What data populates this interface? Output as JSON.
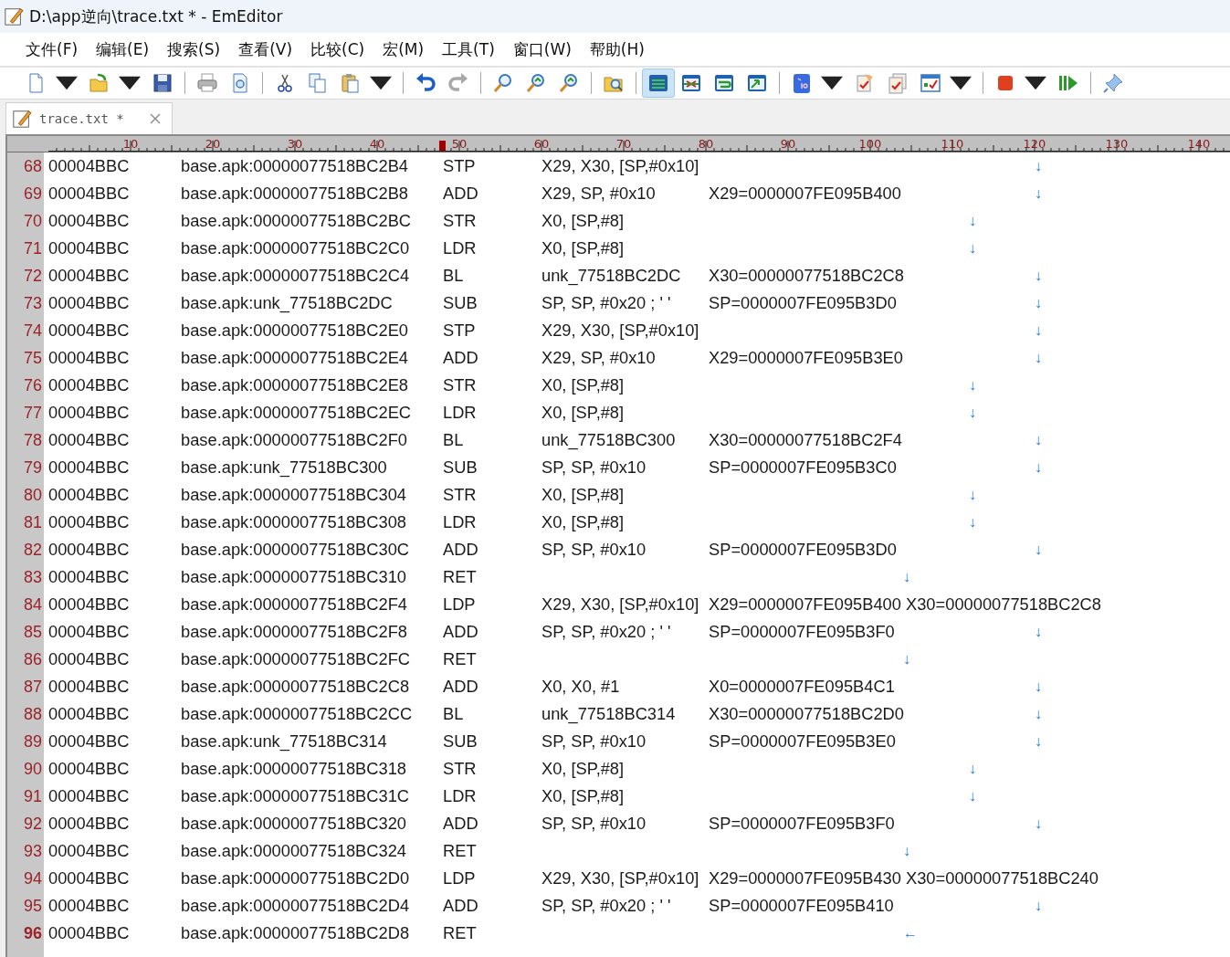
{
  "window": {
    "title": "D:\\app逆向\\trace.txt * - EmEditor"
  },
  "menu": [
    "文件(F)",
    "编辑(E)",
    "搜索(S)",
    "查看(V)",
    "比较(C)",
    "宏(M)",
    "工具(T)",
    "窗口(W)",
    "帮助(H)"
  ],
  "toolbar": [
    {
      "kind": "new",
      "dropdown": true,
      "selected": false
    },
    {
      "kind": "open",
      "dropdown": true,
      "selected": false
    },
    {
      "kind": "save",
      "dropdown": false,
      "selected": false
    },
    {
      "kind": "separator"
    },
    {
      "kind": "print",
      "dropdown": false,
      "selected": false
    },
    {
      "kind": "preview",
      "dropdown": false,
      "selected": false
    },
    {
      "kind": "separator"
    },
    {
      "kind": "cut",
      "dropdown": false,
      "selected": false
    },
    {
      "kind": "copy",
      "dropdown": false,
      "selected": false
    },
    {
      "kind": "paste",
      "dropdown": true,
      "selected": false
    },
    {
      "kind": "separator"
    },
    {
      "kind": "undo",
      "dropdown": false,
      "selected": false
    },
    {
      "kind": "redo",
      "dropdown": false,
      "selected": false
    },
    {
      "kind": "separator"
    },
    {
      "kind": "find",
      "dropdown": false,
      "selected": false
    },
    {
      "kind": "find_next",
      "dropdown": false,
      "selected": false
    },
    {
      "kind": "find_prev",
      "dropdown": false,
      "selected": false
    },
    {
      "kind": "separator"
    },
    {
      "kind": "find_files",
      "dropdown": false,
      "selected": false
    },
    {
      "kind": "separator"
    },
    {
      "kind": "lines",
      "dropdown": false,
      "selected": true
    },
    {
      "kind": "window_x",
      "dropdown": false,
      "selected": false
    },
    {
      "kind": "window_wrap",
      "dropdown": false,
      "selected": false
    },
    {
      "kind": "window_image",
      "dropdown": false,
      "selected": false
    },
    {
      "kind": "separator"
    },
    {
      "kind": "charset",
      "dropdown": true,
      "selected": false
    },
    {
      "kind": "check",
      "dropdown": false,
      "selected": false
    },
    {
      "kind": "check_multi",
      "dropdown": false,
      "selected": false
    },
    {
      "kind": "check_chart",
      "dropdown": true,
      "selected": false
    },
    {
      "kind": "separator"
    },
    {
      "kind": "stop",
      "dropdown": true,
      "selected": false
    },
    {
      "kind": "play",
      "dropdown": false,
      "selected": false
    },
    {
      "kind": "separator"
    },
    {
      "kind": "pin",
      "dropdown": false,
      "selected": false
    }
  ],
  "tabs": [
    {
      "label": "trace.txt *",
      "selected": true
    }
  ],
  "ruler": {
    "labels": [
      "10",
      "20",
      "30",
      "40",
      "50",
      "60",
      "70",
      "80",
      "90",
      "100",
      "110",
      "120",
      "130",
      "140"
    ]
  },
  "lines": [
    {
      "number": "68",
      "current": false,
      "thread": "00004BBC",
      "address": "base.apk:00000077518BC2B4",
      "opcode": "STP",
      "operands": "X29, X30, [SP,#0x10]",
      "arrow": {
        "glyph": "↓",
        "kind": "step"
      }
    },
    {
      "number": "69",
      "current": false,
      "thread": "00004BBC",
      "address": "base.apk:00000077518BC2B8",
      "opcode": "ADD",
      "operands": "X29, SP, #0x10",
      "effect": "X29=0000007FE095B400",
      "arrow": {
        "glyph": "↓",
        "kind": "step"
      }
    },
    {
      "number": "70",
      "current": false,
      "thread": "00004BBC",
      "address": "base.apk:00000077518BC2BC",
      "opcode": "STR",
      "operands": "X0, [SP,#8]",
      "arrow": {
        "glyph": "↓",
        "kind": "memory"
      }
    },
    {
      "number": "71",
      "current": false,
      "thread": "00004BBC",
      "address": "base.apk:00000077518BC2C0",
      "opcode": "LDR",
      "operands": "X0, [SP,#8]",
      "arrow": {
        "glyph": "↓",
        "kind": "memory"
      }
    },
    {
      "number": "72",
      "current": false,
      "thread": "00004BBC",
      "address": "base.apk:00000077518BC2C4",
      "opcode": "BL",
      "operands": "unk_77518BC2DC",
      "effect": "X30=00000077518BC2C8",
      "arrow": {
        "glyph": "↓",
        "kind": "step"
      }
    },
    {
      "number": "73",
      "current": false,
      "thread": "00004BBC",
      "address": "base.apk:unk_77518BC2DC",
      "opcode": "SUB",
      "operands": "SP, SP, #0x20 ; ' '",
      "effect": "SP=0000007FE095B3D0",
      "arrow": {
        "glyph": "↓",
        "kind": "step"
      }
    },
    {
      "number": "74",
      "current": false,
      "thread": "00004BBC",
      "address": "base.apk:00000077518BC2E0",
      "opcode": "STP",
      "operands": "X29, X30, [SP,#0x10]",
      "arrow": {
        "glyph": "↓",
        "kind": "step"
      }
    },
    {
      "number": "75",
      "current": false,
      "thread": "00004BBC",
      "address": "base.apk:00000077518BC2E4",
      "opcode": "ADD",
      "operands": "X29, SP, #0x10",
      "effect": "X29=0000007FE095B3E0",
      "arrow": {
        "glyph": "↓",
        "kind": "step"
      }
    },
    {
      "number": "76",
      "current": false,
      "thread": "00004BBC",
      "address": "base.apk:00000077518BC2E8",
      "opcode": "STR",
      "operands": "X0, [SP,#8]",
      "arrow": {
        "glyph": "↓",
        "kind": "memory"
      }
    },
    {
      "number": "77",
      "current": false,
      "thread": "00004BBC",
      "address": "base.apk:00000077518BC2EC",
      "opcode": "LDR",
      "operands": "X0, [SP,#8]",
      "arrow": {
        "glyph": "↓",
        "kind": "memory"
      }
    },
    {
      "number": "78",
      "current": false,
      "thread": "00004BBC",
      "address": "base.apk:00000077518BC2F0",
      "opcode": "BL",
      "operands": "unk_77518BC300",
      "effect": "X30=00000077518BC2F4",
      "arrow": {
        "glyph": "↓",
        "kind": "step"
      }
    },
    {
      "number": "79",
      "current": false,
      "thread": "00004BBC",
      "address": "base.apk:unk_77518BC300",
      "opcode": "SUB",
      "operands": "SP, SP, #0x10",
      "effect": "SP=0000007FE095B3C0",
      "arrow": {
        "glyph": "↓",
        "kind": "step"
      }
    },
    {
      "number": "80",
      "current": false,
      "thread": "00004BBC",
      "address": "base.apk:00000077518BC304",
      "opcode": "STR",
      "operands": "X0, [SP,#8]",
      "arrow": {
        "glyph": "↓",
        "kind": "memory"
      }
    },
    {
      "number": "81",
      "current": false,
      "thread": "00004BBC",
      "address": "base.apk:00000077518BC308",
      "opcode": "LDR",
      "operands": "X0, [SP,#8]",
      "arrow": {
        "glyph": "↓",
        "kind": "memory"
      }
    },
    {
      "number": "82",
      "current": false,
      "thread": "00004BBC",
      "address": "base.apk:00000077518BC30C",
      "opcode": "ADD",
      "operands": "SP, SP, #0x10",
      "effect": "SP=0000007FE095B3D0",
      "arrow": {
        "glyph": "↓",
        "kind": "step"
      }
    },
    {
      "number": "83",
      "current": false,
      "thread": "00004BBC",
      "address": "base.apk:00000077518BC310",
      "opcode": "RET",
      "arrow": {
        "glyph": "↓",
        "kind": "return"
      }
    },
    {
      "number": "84",
      "current": false,
      "thread": "00004BBC",
      "address": "base.apk:00000077518BC2F4",
      "opcode": "LDP",
      "operands": "X29, X30, [SP,#0x10]",
      "effect": "X29=0000007FE095B400 X30=00000077518BC2C8"
    },
    {
      "number": "85",
      "current": false,
      "thread": "00004BBC",
      "address": "base.apk:00000077518BC2F8",
      "opcode": "ADD",
      "operands": "SP, SP, #0x20 ; ' '",
      "effect": "SP=0000007FE095B3F0",
      "arrow": {
        "glyph": "↓",
        "kind": "step"
      }
    },
    {
      "number": "86",
      "current": false,
      "thread": "00004BBC",
      "address": "base.apk:00000077518BC2FC",
      "opcode": "RET",
      "arrow": {
        "glyph": "↓",
        "kind": "return"
      }
    },
    {
      "number": "87",
      "current": false,
      "thread": "00004BBC",
      "address": "base.apk:00000077518BC2C8",
      "opcode": "ADD",
      "operands": "X0, X0, #1",
      "effect": "X0=0000007FE095B4C1",
      "arrow": {
        "glyph": "↓",
        "kind": "step"
      }
    },
    {
      "number": "88",
      "current": false,
      "thread": "00004BBC",
      "address": "base.apk:00000077518BC2CC",
      "opcode": "BL",
      "operands": "unk_77518BC314",
      "effect": "X30=00000077518BC2D0",
      "arrow": {
        "glyph": "↓",
        "kind": "step"
      }
    },
    {
      "number": "89",
      "current": false,
      "thread": "00004BBC",
      "address": "base.apk:unk_77518BC314",
      "opcode": "SUB",
      "operands": "SP, SP, #0x10",
      "effect": "SP=0000007FE095B3E0",
      "arrow": {
        "glyph": "↓",
        "kind": "step"
      }
    },
    {
      "number": "90",
      "current": false,
      "thread": "00004BBC",
      "address": "base.apk:00000077518BC318",
      "opcode": "STR",
      "operands": "X0, [SP,#8]",
      "arrow": {
        "glyph": "↓",
        "kind": "memory"
      }
    },
    {
      "number": "91",
      "current": false,
      "thread": "00004BBC",
      "address": "base.apk:00000077518BC31C",
      "opcode": "LDR",
      "operands": "X0, [SP,#8]",
      "arrow": {
        "glyph": "↓",
        "kind": "memory"
      }
    },
    {
      "number": "92",
      "current": false,
      "thread": "00004BBC",
      "address": "base.apk:00000077518BC320",
      "opcode": "ADD",
      "operands": "SP, SP, #0x10",
      "effect": "SP=0000007FE095B3F0",
      "arrow": {
        "glyph": "↓",
        "kind": "step"
      }
    },
    {
      "number": "93",
      "current": false,
      "thread": "00004BBC",
      "address": "base.apk:00000077518BC324",
      "opcode": "RET",
      "arrow": {
        "glyph": "↓",
        "kind": "return"
      }
    },
    {
      "number": "94",
      "current": false,
      "thread": "00004BBC",
      "address": "base.apk:00000077518BC2D0",
      "opcode": "LDP",
      "operands": "X29, X30, [SP,#0x10]",
      "effect": "X29=0000007FE095B430 X30=00000077518BC240"
    },
    {
      "number": "95",
      "current": false,
      "thread": "00004BBC",
      "address": "base.apk:00000077518BC2D4",
      "opcode": "ADD",
      "operands": "SP, SP, #0x20 ; ' '",
      "effect": "SP=0000007FE095B410",
      "arrow": {
        "glyph": "↓",
        "kind": "step"
      }
    },
    {
      "number": "96",
      "current": true,
      "thread": "00004BBC",
      "address": "base.apk:00000077518BC2D8",
      "opcode": "RET",
      "arrow": {
        "glyph": "←",
        "kind": "return"
      }
    }
  ]
}
